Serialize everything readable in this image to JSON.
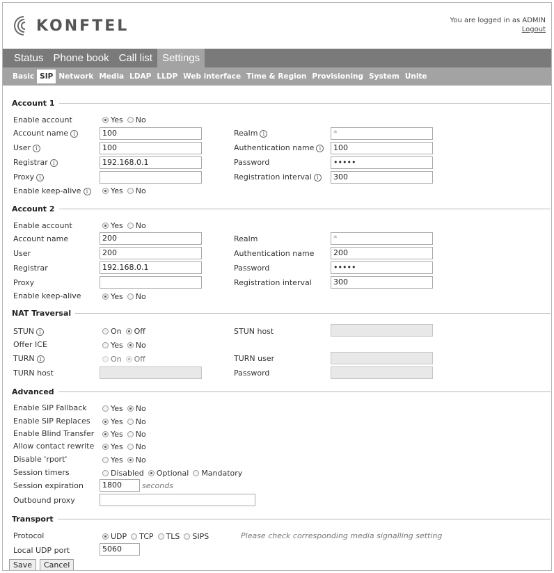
{
  "header": {
    "logo_text": "KONFTEL",
    "logged_in_text": "You are logged in as ADMIN",
    "logout_label": "Logout"
  },
  "main_nav": [
    {
      "label": "Status"
    },
    {
      "label": "Phone book"
    },
    {
      "label": "Call list"
    },
    {
      "label": "Settings",
      "active": true
    }
  ],
  "sub_nav": [
    {
      "label": "Basic"
    },
    {
      "label": "SIP",
      "active": true
    },
    {
      "label": "Network"
    },
    {
      "label": "Media"
    },
    {
      "label": "LDAP"
    },
    {
      "label": "LLDP"
    },
    {
      "label": "Web interface"
    },
    {
      "label": "Time & Region"
    },
    {
      "label": "Provisioning"
    },
    {
      "label": "System"
    },
    {
      "label": "Unite"
    }
  ],
  "radio_labels": {
    "yes": "Yes",
    "no": "No",
    "on": "On",
    "off": "Off",
    "disabled": "Disabled",
    "optional": "Optional",
    "mandatory": "Mandatory",
    "udp": "UDP",
    "tcp": "TCP",
    "tls": "TLS",
    "sips": "SIPS"
  },
  "account1": {
    "title": "Account 1",
    "enable_account_label": "Enable account",
    "enable_account_value": "Yes",
    "account_name_label": "Account name",
    "account_name_value": "100",
    "user_label": "User",
    "user_value": "100",
    "registrar_label": "Registrar",
    "registrar_value": "192.168.0.1",
    "proxy_label": "Proxy",
    "proxy_value": "",
    "keepalive_label": "Enable keep-alive",
    "keepalive_value": "Yes",
    "realm_label": "Realm",
    "realm_value": "*",
    "auth_name_label": "Authentication name",
    "auth_name_value": "100",
    "password_label": "Password",
    "password_value": "•••••",
    "reg_interval_label": "Registration interval",
    "reg_interval_value": "300"
  },
  "account2": {
    "title": "Account 2",
    "enable_account_label": "Enable account",
    "enable_account_value": "Yes",
    "account_name_label": "Account name",
    "account_name_value": "200",
    "user_label": "User",
    "user_value": "200",
    "registrar_label": "Registrar",
    "registrar_value": "192.168.0.1",
    "proxy_label": "Proxy",
    "proxy_value": "",
    "keepalive_label": "Enable keep-alive",
    "keepalive_value": "Yes",
    "realm_label": "Realm",
    "realm_value": "*",
    "auth_name_label": "Authentication name",
    "auth_name_value": "200",
    "password_label": "Password",
    "password_value": "•••••",
    "reg_interval_label": "Registration interval",
    "reg_interval_value": "300"
  },
  "nat": {
    "title": "NAT Traversal",
    "stun_label": "STUN",
    "stun_value": "Off",
    "offer_ice_label": "Offer ICE",
    "offer_ice_value": "No",
    "turn_label": "TURN",
    "turn_value": "Off",
    "turn_host_label": "TURN host",
    "turn_host_value": "",
    "stun_host_label": "STUN host",
    "stun_host_value": "",
    "turn_user_label": "TURN user",
    "turn_user_value": "",
    "password_label": "Password",
    "password_value": ""
  },
  "advanced": {
    "title": "Advanced",
    "sip_fallback_label": "Enable SIP Fallback",
    "sip_fallback_value": "No",
    "sip_replaces_label": "Enable SIP Replaces",
    "sip_replaces_value": "Yes",
    "blind_transfer_label": "Enable Blind Transfer",
    "blind_transfer_value": "Yes",
    "contact_rewrite_label": "Allow contact rewrite",
    "contact_rewrite_value": "Yes",
    "disable_rport_label": "Disable 'rport'",
    "disable_rport_value": "No",
    "session_timers_label": "Session timers",
    "session_timers_value": "Optional",
    "session_expiration_label": "Session expiration",
    "session_expiration_value": "1800",
    "session_expiration_unit": "seconds",
    "outbound_proxy_label": "Outbound proxy",
    "outbound_proxy_value": ""
  },
  "transport": {
    "title": "Transport",
    "protocol_label": "Protocol",
    "protocol_value": "UDP",
    "protocol_hint": "Please check corresponding media signalling setting",
    "local_port_label": "Local UDP port",
    "local_port_value": "5060"
  },
  "buttons": {
    "save": "Save",
    "cancel": "Cancel"
  }
}
